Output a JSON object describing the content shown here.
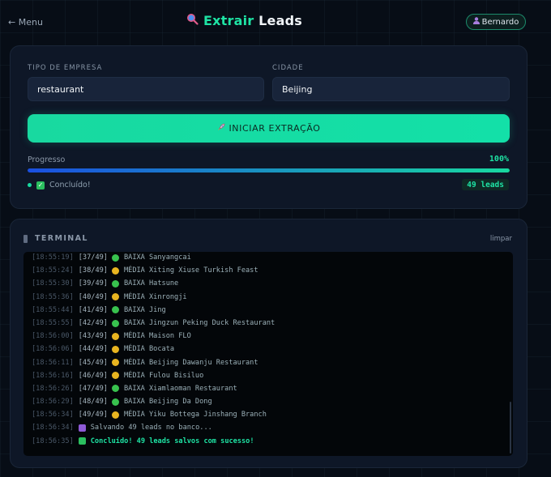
{
  "header": {
    "menu_label": "← Menu",
    "brand_part1": "Extrair",
    "brand_part2": "Leads",
    "user_name": "Bernardo"
  },
  "form": {
    "company_type_label": "TIPO DE EMPRESA",
    "company_type_value": "restaurant",
    "city_label": "CIDADE",
    "city_value": "Beijing",
    "start_button": "INICIAR EXTRAÇÃO"
  },
  "progress": {
    "label": "Progresso",
    "percent_text": "100%",
    "value": 100,
    "status_text": "Concluído!",
    "leads_badge": "49 leads"
  },
  "terminal": {
    "title": "TERMINAL",
    "clear_label": "limpar",
    "lines": [
      {
        "ts": "[18:55:19]",
        "idx": "[37/49]",
        "icon": "green",
        "msg": "BAIXA Sanyangcai"
      },
      {
        "ts": "[18:55:24]",
        "idx": "[38/49]",
        "icon": "yellow",
        "msg": "MÉDIA Xiting Xiuse Turkish Feast"
      },
      {
        "ts": "[18:55:30]",
        "idx": "[39/49]",
        "icon": "green",
        "msg": "BAIXA Hatsune"
      },
      {
        "ts": "[18:55:36]",
        "idx": "[40/49]",
        "icon": "yellow",
        "msg": "MÉDIA Xinrongji"
      },
      {
        "ts": "[18:55:44]",
        "idx": "[41/49]",
        "icon": "green",
        "msg": "BAIXA Jing"
      },
      {
        "ts": "[18:55:55]",
        "idx": "[42/49]",
        "icon": "green",
        "msg": "BAIXA Jingzun Peking Duck Restaurant"
      },
      {
        "ts": "[18:56:00]",
        "idx": "[43/49]",
        "icon": "yellow",
        "msg": "MÉDIA Maison FLO"
      },
      {
        "ts": "[18:56:06]",
        "idx": "[44/49]",
        "icon": "yellow",
        "msg": "MÉDIA Bocata"
      },
      {
        "ts": "[18:56:11]",
        "idx": "[45/49]",
        "icon": "yellow",
        "msg": "MÉDIA Beijing Dawanju Restaurant"
      },
      {
        "ts": "[18:56:16]",
        "idx": "[46/49]",
        "icon": "yellow",
        "msg": "MÉDIA Fulou Bisiluo"
      },
      {
        "ts": "[18:56:26]",
        "idx": "[47/49]",
        "icon": "green",
        "msg": "BAIXA Xiamlaoman Restaurant"
      },
      {
        "ts": "[18:56:29]",
        "idx": "[48/49]",
        "icon": "green",
        "msg": "BAIXA Beijing Da Dong"
      },
      {
        "ts": "[18:56:34]",
        "idx": "[49/49]",
        "icon": "yellow",
        "msg": "MÉDIA Yiku Bottega Jinshang Branch"
      },
      {
        "ts": "[18:56:34]",
        "idx": "",
        "icon": "floppy",
        "msg": "Salvando 49 leads no banco..."
      },
      {
        "ts": "[18:56:35]",
        "idx": "",
        "icon": "check",
        "msg": "Concluído! 49 leads salvos com sucesso!"
      }
    ]
  },
  "colors": {
    "accent": "#1ee3a4",
    "background": "#070d16",
    "card": "#0e1727"
  }
}
